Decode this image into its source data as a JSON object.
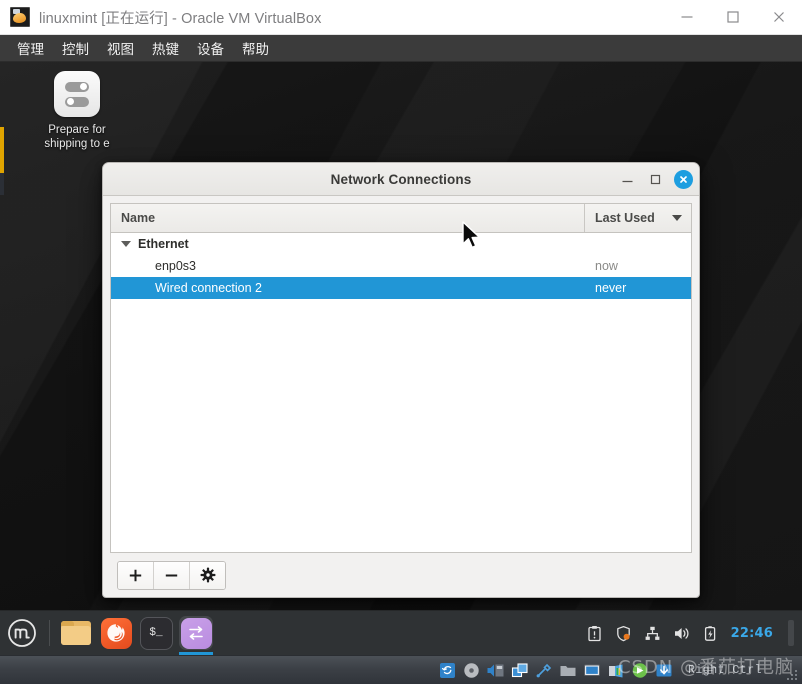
{
  "vbox": {
    "title": "linuxmint [正在运行] - Oracle VM VirtualBox",
    "app_icon": "virtualbox-vm-icon",
    "window_buttons": [
      {
        "name": "minimize",
        "glyph": "minimize-icon"
      },
      {
        "name": "maximize",
        "glyph": "maximize-icon"
      },
      {
        "name": "close",
        "glyph": "close-icon"
      }
    ],
    "menubar": [
      {
        "label": "管理"
      },
      {
        "label": "控制"
      },
      {
        "label": "视图"
      },
      {
        "label": "热键"
      },
      {
        "label": "设备"
      },
      {
        "label": "帮助"
      }
    ],
    "statusbar": {
      "host_key": "Right Ctrl",
      "icons": [
        "hard-disk-icon",
        "optical-disk-icon",
        "audio-icon",
        "network-icon",
        "usb-icon",
        "shared-folder-icon",
        "display-icon",
        "recording-icon",
        "video-capture-icon",
        "mouse-integration-icon",
        "keyboard-icon"
      ]
    }
  },
  "desktop": {
    "icon": {
      "name": "prepare-for-shipping",
      "label": "Prepare for shipping to e",
      "glyph": "toggle-switches-icon"
    }
  },
  "dialog": {
    "title": "Network Connections",
    "window_buttons": [
      {
        "name": "minimize",
        "glyph": "minimize-icon"
      },
      {
        "name": "maximize",
        "glyph": "maximize-icon"
      },
      {
        "name": "close",
        "glyph": "close-circle-icon"
      }
    ],
    "columns": [
      {
        "key": "name",
        "label": "Name"
      },
      {
        "key": "last_used",
        "label": "Last Used",
        "sorted": true,
        "sort_dir": "desc"
      }
    ],
    "groups": [
      {
        "label": "Ethernet",
        "expanded": true,
        "rows": [
          {
            "name": "enp0s3",
            "last_used": "now",
            "selected": false
          },
          {
            "name": "Wired connection 2",
            "last_used": "never",
            "selected": true
          }
        ]
      }
    ],
    "toolbar": [
      {
        "name": "add-connection",
        "glyph": "plus-icon"
      },
      {
        "name": "remove-connection",
        "glyph": "minus-icon"
      },
      {
        "name": "edit-connection",
        "glyph": "gear-icon"
      }
    ],
    "selection_color": "#2196d6"
  },
  "panel": {
    "menu_button": "linux-mint-menu-icon",
    "launchers": [
      {
        "name": "files",
        "glyph": "folder-icon",
        "active": false
      },
      {
        "name": "firefox",
        "glyph": "firefox-icon",
        "active": false
      },
      {
        "name": "terminal",
        "glyph": "terminal-icon",
        "label": "$_",
        "active": false
      },
      {
        "name": "network-connections",
        "glyph": "network-exchange-icon",
        "active": true
      }
    ],
    "tray": [
      {
        "name": "update-manager",
        "glyph": "clipboard-alert-icon"
      },
      {
        "name": "firewall",
        "glyph": "shield-icon"
      },
      {
        "name": "network",
        "glyph": "network-tree-icon"
      },
      {
        "name": "volume",
        "glyph": "speaker-icon"
      },
      {
        "name": "battery",
        "glyph": "battery-charging-icon"
      }
    ],
    "clock": "22:46",
    "accent_color": "#3aa8e8"
  },
  "watermark": "CSDN @番茄打电脑"
}
